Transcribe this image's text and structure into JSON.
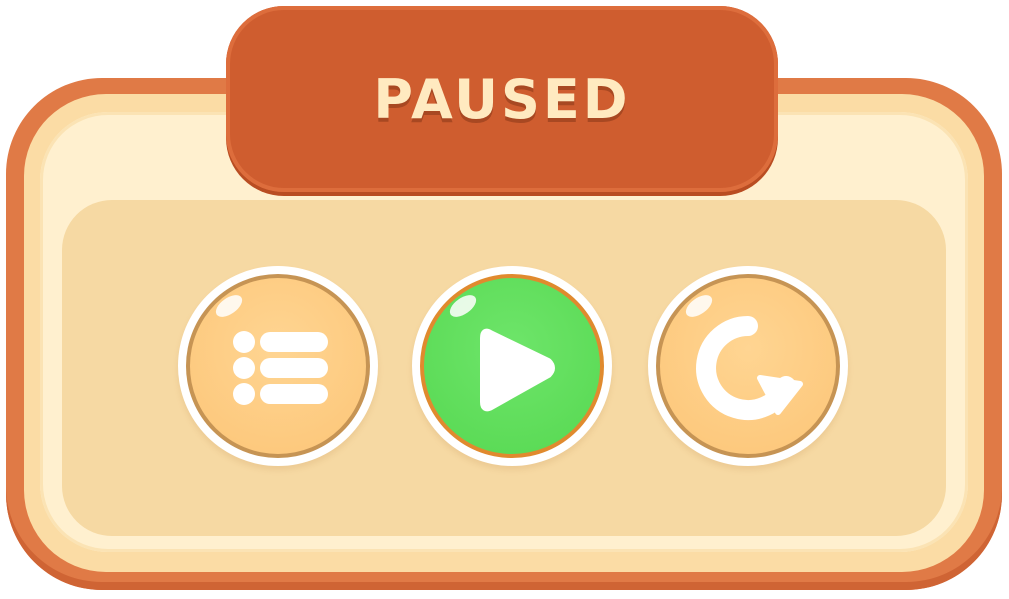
{
  "dialog": {
    "title": "PAUSED"
  },
  "buttons": [
    {
      "id": "menu",
      "icon": "menu-list-icon"
    },
    {
      "id": "play",
      "icon": "play-icon"
    },
    {
      "id": "restart",
      "icon": "restart-icon"
    }
  ],
  "colors": {
    "frame": "#e07a46",
    "title_plate": "#cf5d2f",
    "title_text": "#ffeac0",
    "panel": "#f6d9a3",
    "button_orange": "#fcc577",
    "button_green": "#56d851"
  }
}
